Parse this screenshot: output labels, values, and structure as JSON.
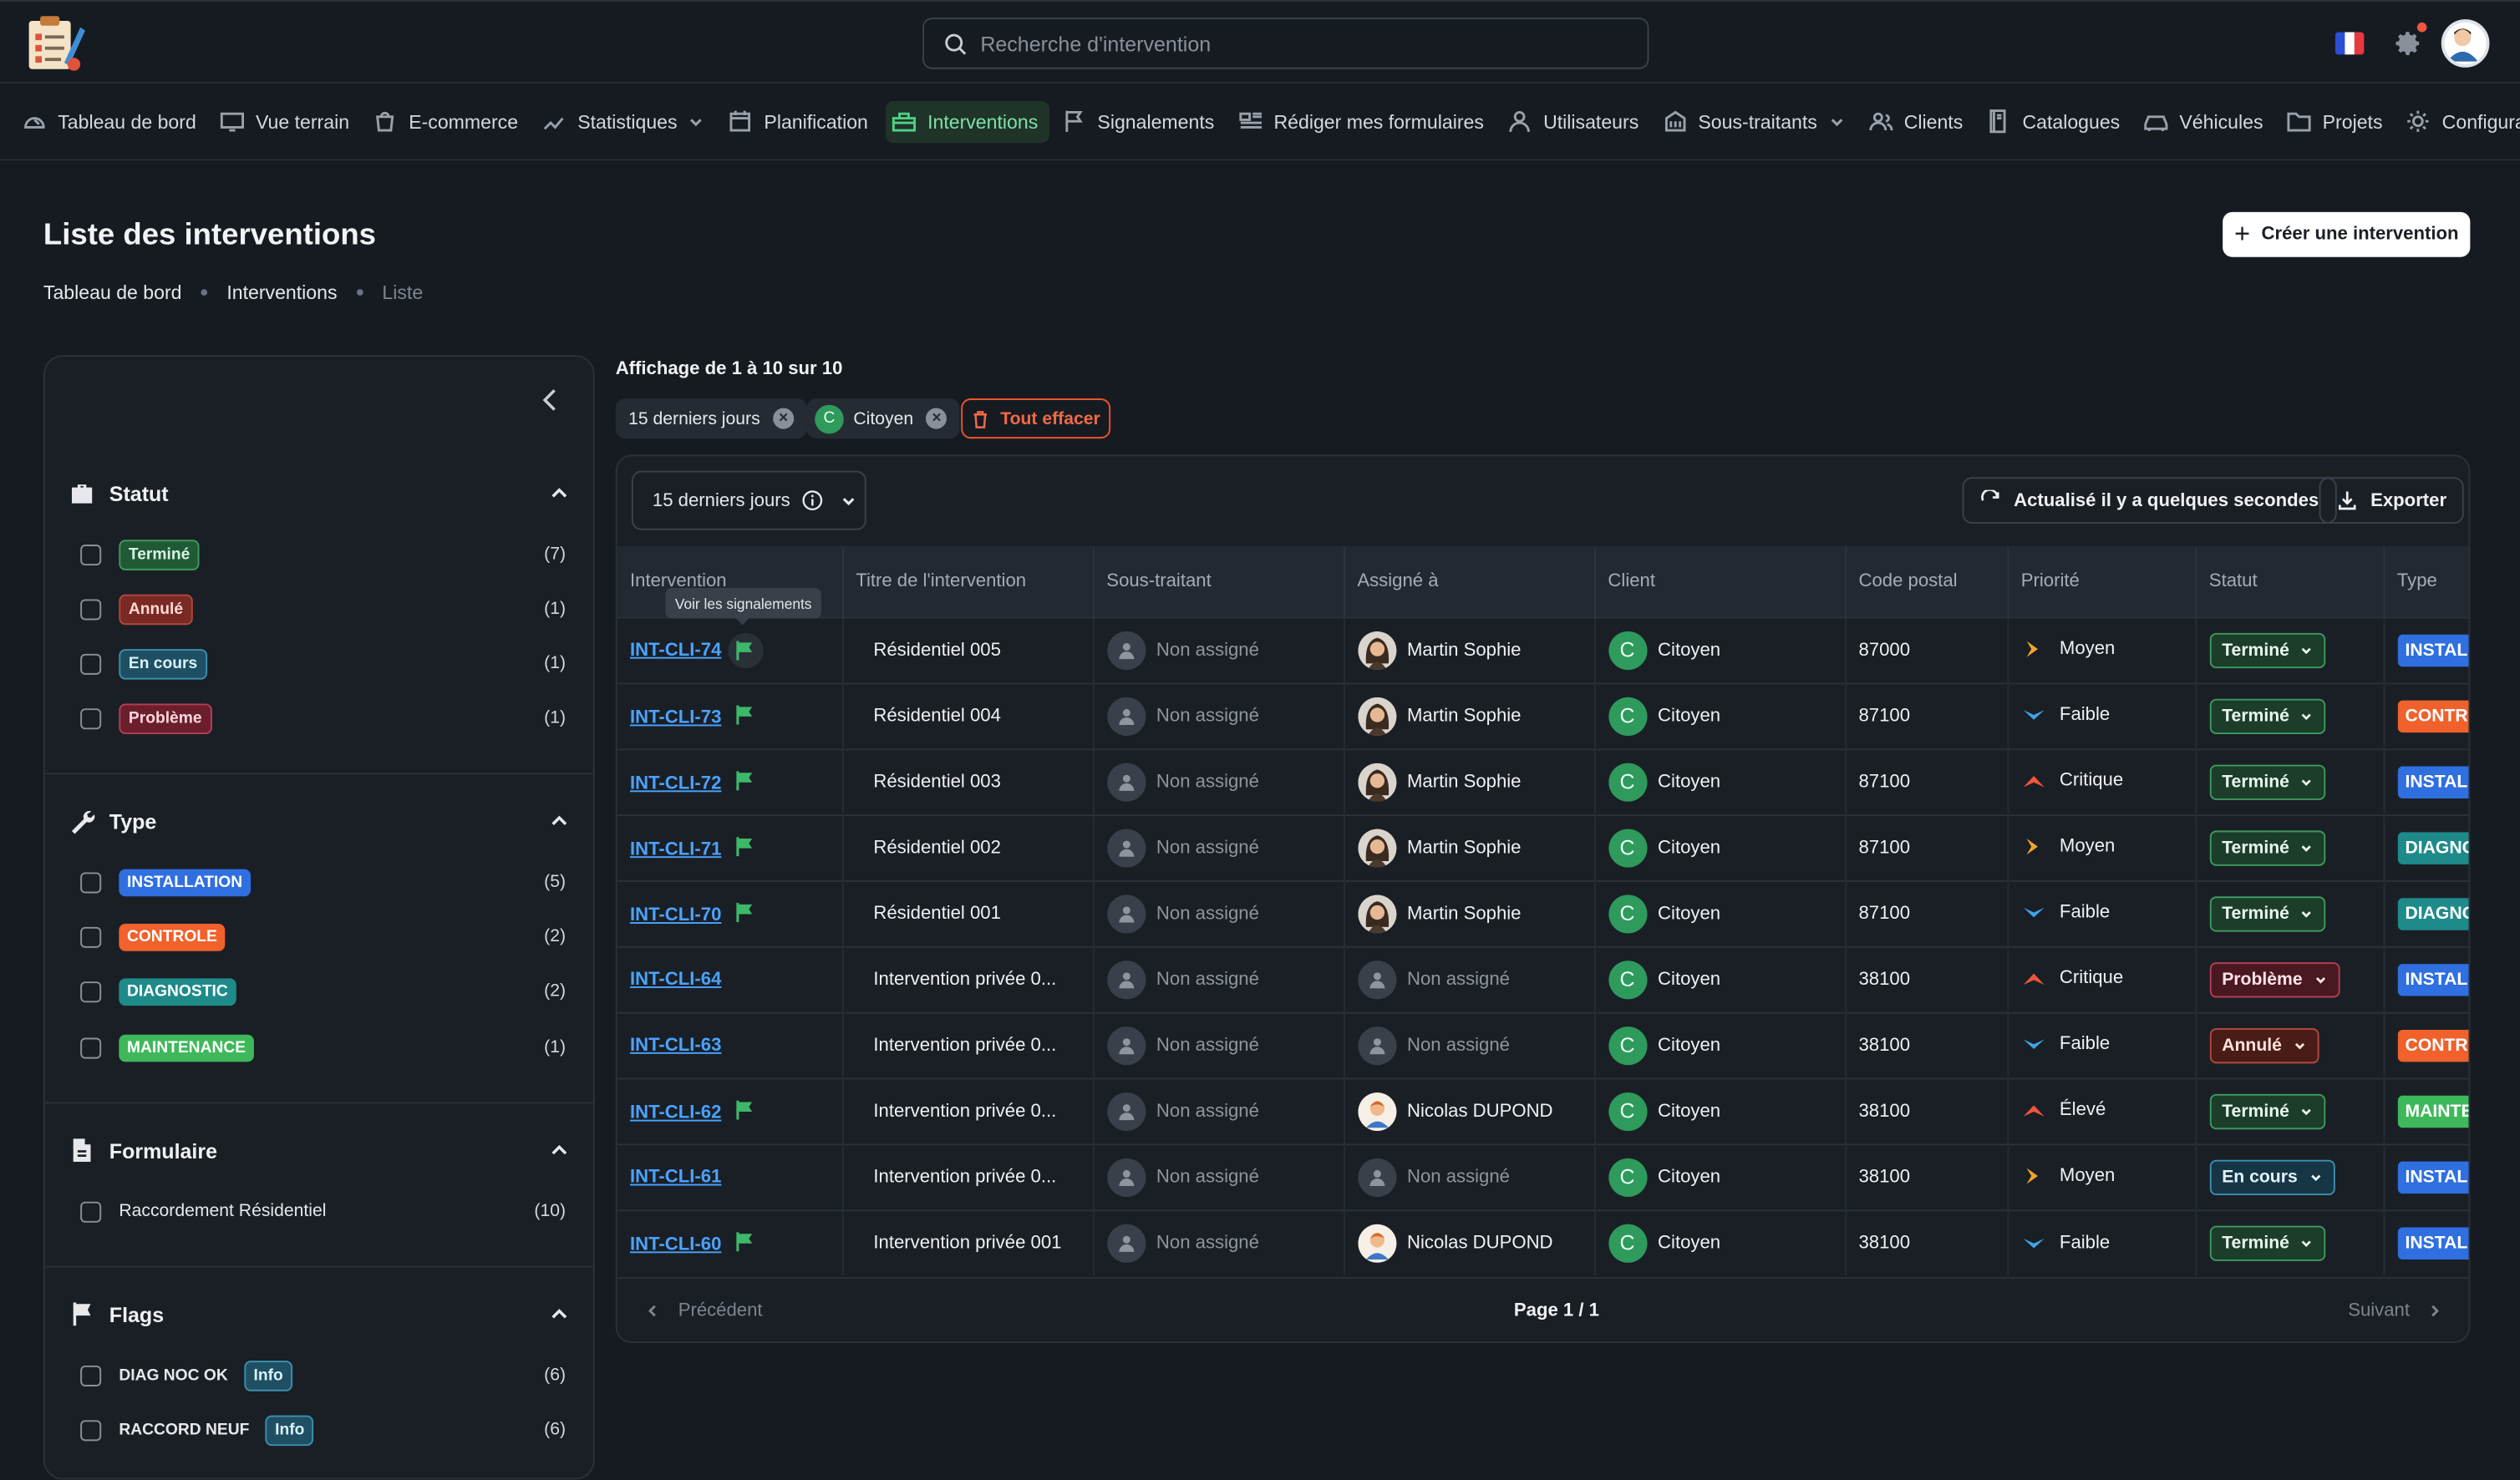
{
  "search": {
    "placeholder": "Recherche d'intervention"
  },
  "nav": [
    {
      "label": "Tableau de bord",
      "icon": "dashboard-icon"
    },
    {
      "label": "Vue terrain",
      "icon": "monitor-icon"
    },
    {
      "label": "E-commerce",
      "icon": "shopping-bag-icon"
    },
    {
      "label": "Statistiques",
      "icon": "chart-icon",
      "dropdown": true
    },
    {
      "label": "Planification",
      "icon": "calendar-icon"
    },
    {
      "label": "Interventions",
      "icon": "toolbox-icon",
      "active": true
    },
    {
      "label": "Signalements",
      "icon": "flag-icon"
    },
    {
      "label": "Rédiger mes formulaires",
      "icon": "form-icon"
    },
    {
      "label": "Utilisateurs",
      "icon": "user-icon"
    },
    {
      "label": "Sous-traitants",
      "icon": "building-icon",
      "dropdown": true
    },
    {
      "label": "Clients",
      "icon": "users-icon"
    },
    {
      "label": "Catalogues",
      "icon": "book-icon"
    },
    {
      "label": "Véhicules",
      "icon": "car-icon"
    },
    {
      "label": "Projets",
      "icon": "folder-icon"
    },
    {
      "label": "Configuratio",
      "icon": "gear-icon"
    }
  ],
  "header": {
    "title": "Liste des interventions",
    "create_label": "Créer une intervention",
    "breadcrumb": [
      "Tableau de bord",
      "Interventions",
      "Liste"
    ]
  },
  "filters": {
    "statut": {
      "title": "Statut",
      "items": [
        {
          "label": "Terminé",
          "count": "(7)",
          "bg": "#1f5a35",
          "fg": "#d7f5e1",
          "border": "#3d9a5e"
        },
        {
          "label": "Annulé",
          "count": "(1)",
          "bg": "#7a2a24",
          "fg": "#ffd9d4",
          "border": "#b3473d"
        },
        {
          "label": "En cours",
          "count": "(1)",
          "bg": "#1f4f63",
          "fg": "#d8f2fb",
          "border": "#3b8fb0"
        },
        {
          "label": "Problème",
          "count": "(1)",
          "bg": "#6b1f2c",
          "fg": "#ffd6dd",
          "border": "#b33f55"
        }
      ]
    },
    "type": {
      "title": "Type",
      "items": [
        {
          "label": "INSTALLATION",
          "count": "(5)",
          "bg": "#2f6fe0"
        },
        {
          "label": "CONTROLE",
          "count": "(2)",
          "bg": "#f0612c"
        },
        {
          "label": "DIAGNOSTIC",
          "count": "(2)",
          "bg": "#1f8a8a"
        },
        {
          "label": "MAINTENANCE",
          "count": "(1)",
          "bg": "#3eb85b"
        }
      ]
    },
    "formulaire": {
      "title": "Formulaire",
      "items": [
        {
          "label": "Raccordement Résidentiel",
          "count": "(10)"
        }
      ]
    },
    "flags": {
      "title": "Flags",
      "items": [
        {
          "label": "DIAG NOC OK",
          "badge": "Info",
          "count": "(6)"
        },
        {
          "label": "RACCORD NEUF",
          "badge": "Info",
          "count": "(6)"
        }
      ]
    }
  },
  "results": {
    "summary": "Affichage de 1 à 10 sur 10",
    "chips": [
      "15 derniers jours",
      "Citoyen"
    ],
    "chip_client_letter": "C",
    "clear_label": "Tout effacer"
  },
  "toolbar": {
    "period": "15 derniers jours",
    "refresh_label": "Actualisé il y a quelques secondes",
    "export_label": "Exporter"
  },
  "table": {
    "columns": [
      "Intervention",
      "Titre de l'intervention",
      "Sous-traitant",
      "Assigné à",
      "Client",
      "Code postal",
      "Priorité",
      "Statut",
      "Type"
    ],
    "tooltip": "Voir les signalements",
    "rows": [
      {
        "id": "INT-CLI-74",
        "flag": true,
        "title": "Résidentiel 005",
        "sub": "Non assigné",
        "assignee": "Martin Sophie",
        "assignee_avatar": "woman",
        "client": "Citoyen",
        "client_letter": "C",
        "cp": "87000",
        "priority": "Moyen",
        "status": "Terminé",
        "type": "INSTALLATION"
      },
      {
        "id": "INT-CLI-73",
        "flag": true,
        "title": "Résidentiel 004",
        "sub": "Non assigné",
        "assignee": "Martin Sophie",
        "assignee_avatar": "woman",
        "client": "Citoyen",
        "client_letter": "C",
        "cp": "87100",
        "priority": "Faible",
        "status": "Terminé",
        "type": "CONTROLE"
      },
      {
        "id": "INT-CLI-72",
        "flag": true,
        "title": "Résidentiel 003",
        "sub": "Non assigné",
        "assignee": "Martin Sophie",
        "assignee_avatar": "woman",
        "client": "Citoyen",
        "client_letter": "C",
        "cp": "87100",
        "priority": "Critique",
        "status": "Terminé",
        "type": "INSTALLATION"
      },
      {
        "id": "INT-CLI-71",
        "flag": true,
        "title": "Résidentiel 002",
        "sub": "Non assigné",
        "assignee": "Martin Sophie",
        "assignee_avatar": "woman",
        "client": "Citoyen",
        "client_letter": "C",
        "cp": "87100",
        "priority": "Moyen",
        "status": "Terminé",
        "type": "DIAGNOSTIC"
      },
      {
        "id": "INT-CLI-70",
        "flag": true,
        "title": "Résidentiel 001",
        "sub": "Non assigné",
        "assignee": "Martin Sophie",
        "assignee_avatar": "woman",
        "client": "Citoyen",
        "client_letter": "C",
        "cp": "87100",
        "priority": "Faible",
        "status": "Terminé",
        "type": "DIAGNOSTIC"
      },
      {
        "id": "INT-CLI-64",
        "flag": false,
        "title": "Intervention privée 0...",
        "sub": "Non assigné",
        "assignee": "Non assigné",
        "assignee_avatar": "none",
        "client": "Citoyen",
        "client_letter": "C",
        "cp": "38100",
        "priority": "Critique",
        "status": "Problème",
        "type": "INSTALLATION"
      },
      {
        "id": "INT-CLI-63",
        "flag": false,
        "title": "Intervention privée 0...",
        "sub": "Non assigné",
        "assignee": "Non assigné",
        "assignee_avatar": "none",
        "client": "Citoyen",
        "client_letter": "C",
        "cp": "38100",
        "priority": "Faible",
        "status": "Annulé",
        "type": "CONTROLE"
      },
      {
        "id": "INT-CLI-62",
        "flag": true,
        "title": "Intervention privée 0...",
        "sub": "Non assigné",
        "assignee": "Nicolas DUPOND",
        "assignee_avatar": "man",
        "client": "Citoyen",
        "client_letter": "C",
        "cp": "38100",
        "priority": "Élevé",
        "status": "Terminé",
        "type": "MAINTENANCE"
      },
      {
        "id": "INT-CLI-61",
        "flag": false,
        "title": "Intervention privée 0...",
        "sub": "Non assigné",
        "assignee": "Non assigné",
        "assignee_avatar": "none",
        "client": "Citoyen",
        "client_letter": "C",
        "cp": "38100",
        "priority": "Moyen",
        "status": "En cours",
        "type": "INSTALLATION"
      },
      {
        "id": "INT-CLI-60",
        "flag": true,
        "title": "Intervention privée 001",
        "sub": "Non assigné",
        "assignee": "Nicolas DUPOND",
        "assignee_avatar": "man",
        "client": "Citoyen",
        "client_letter": "C",
        "cp": "38100",
        "priority": "Faible",
        "status": "Terminé",
        "type": "INSTALLATION"
      }
    ]
  },
  "pagination": {
    "prev": "Précédent",
    "page": "Page 1 / 1",
    "next": "Suivant"
  },
  "colors": {
    "accent_green": "#4fd186",
    "link_blue": "#4aa3ff",
    "status": {
      "Terminé": {
        "bg": "#1c3d2a",
        "fg": "#e9f7ee",
        "border": "#3d9a5e"
      },
      "Problème": {
        "bg": "#4a1820",
        "fg": "#ffe3e8",
        "border": "#b33f55"
      },
      "Annulé": {
        "bg": "#4a1c18",
        "fg": "#ffe2de",
        "border": "#b3473d"
      },
      "En cours": {
        "bg": "#163646",
        "fg": "#e1f4fb",
        "border": "#3b8fb0"
      }
    },
    "type": {
      "INSTALLATION": "#2f6fe0",
      "CONTROLE": "#f0612c",
      "DIAGNOSTIC": "#1f8a8a",
      "MAINTENANCE": "#3eb85b"
    }
  }
}
